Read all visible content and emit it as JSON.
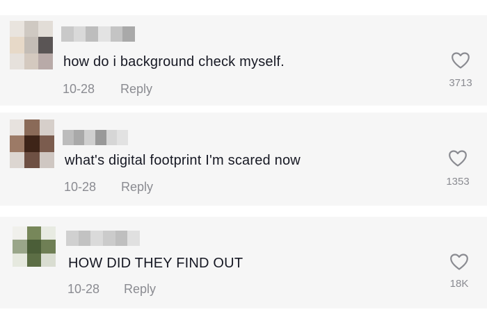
{
  "comments": [
    {
      "text": "how do i background check myself.",
      "date": "10-28",
      "reply_label": "Reply",
      "likes": "3713",
      "avatar_colors": [
        "#e9e4de",
        "#cfc9c2",
        "#e2ddd7",
        "#e7d9c8",
        "#c4bdb6",
        "#5a5555",
        "#e6e1dc",
        "#d4c9bf",
        "#b8aaa8"
      ],
      "username_colors": [
        "#c9c9c9",
        "#d9d9d9",
        "#bdbdbd",
        "#e3e3e3",
        "#c4c4c4",
        "#a9a9a9"
      ]
    },
    {
      "text": "what's digital footprint I'm scared now",
      "date": "10-28",
      "reply_label": "Reply",
      "likes": "1353",
      "avatar_colors": [
        "#e7e2de",
        "#8a6a58",
        "#d6cfca",
        "#9c7a66",
        "#3e2418",
        "#7b5c4e",
        "#dcd6d1",
        "#6e5043",
        "#cfc7c2"
      ],
      "username_colors": [
        "#bcbcbc",
        "#a9a9a9",
        "#cfcfcf",
        "#999999",
        "#d6d6d6",
        "#e2e2e2"
      ]
    },
    {
      "text": "HOW DID THEY FIND OUT",
      "date": "10-28",
      "reply_label": "Reply",
      "likes": "18K",
      "avatar_colors": [
        "#f0f0ec",
        "#77875a",
        "#e8ebe2",
        "#9aa68a",
        "#4b5e38",
        "#6f7f55",
        "#e6e9df",
        "#5c6e45",
        "#d9ddd1"
      ],
      "username_colors": [
        "#d0d0d0",
        "#c2c2c2",
        "#dadada",
        "#cbcbcb",
        "#bfbfbf",
        "#e0e0e0"
      ]
    }
  ],
  "icons": {
    "like": "heart-outline-icon"
  },
  "colors": {
    "text": "#161823",
    "secondary": "#8a8b91",
    "card_bg": "#f6f6f6"
  }
}
